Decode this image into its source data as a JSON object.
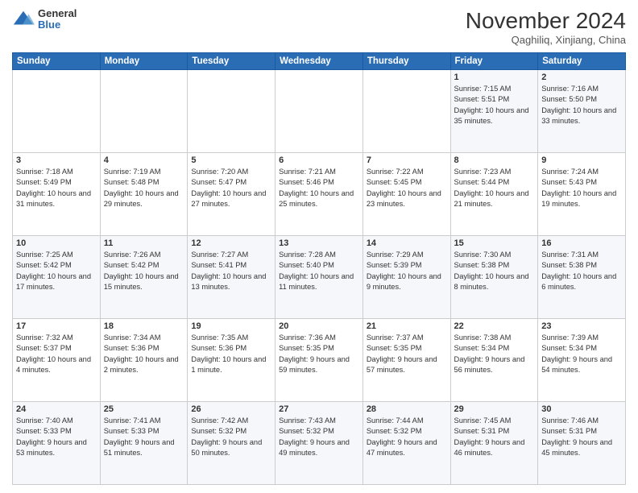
{
  "header": {
    "logo_general": "General",
    "logo_blue": "Blue",
    "month_title": "November 2024",
    "location": "Qaghiliq, Xinjiang, China"
  },
  "weekdays": [
    "Sunday",
    "Monday",
    "Tuesday",
    "Wednesday",
    "Thursday",
    "Friday",
    "Saturday"
  ],
  "weeks": [
    [
      {
        "day": "",
        "info": ""
      },
      {
        "day": "",
        "info": ""
      },
      {
        "day": "",
        "info": ""
      },
      {
        "day": "",
        "info": ""
      },
      {
        "day": "",
        "info": ""
      },
      {
        "day": "1",
        "info": "Sunrise: 7:15 AM\nSunset: 5:51 PM\nDaylight: 10 hours and 35 minutes."
      },
      {
        "day": "2",
        "info": "Sunrise: 7:16 AM\nSunset: 5:50 PM\nDaylight: 10 hours and 33 minutes."
      }
    ],
    [
      {
        "day": "3",
        "info": "Sunrise: 7:18 AM\nSunset: 5:49 PM\nDaylight: 10 hours and 31 minutes."
      },
      {
        "day": "4",
        "info": "Sunrise: 7:19 AM\nSunset: 5:48 PM\nDaylight: 10 hours and 29 minutes."
      },
      {
        "day": "5",
        "info": "Sunrise: 7:20 AM\nSunset: 5:47 PM\nDaylight: 10 hours and 27 minutes."
      },
      {
        "day": "6",
        "info": "Sunrise: 7:21 AM\nSunset: 5:46 PM\nDaylight: 10 hours and 25 minutes."
      },
      {
        "day": "7",
        "info": "Sunrise: 7:22 AM\nSunset: 5:45 PM\nDaylight: 10 hours and 23 minutes."
      },
      {
        "day": "8",
        "info": "Sunrise: 7:23 AM\nSunset: 5:44 PM\nDaylight: 10 hours and 21 minutes."
      },
      {
        "day": "9",
        "info": "Sunrise: 7:24 AM\nSunset: 5:43 PM\nDaylight: 10 hours and 19 minutes."
      }
    ],
    [
      {
        "day": "10",
        "info": "Sunrise: 7:25 AM\nSunset: 5:42 PM\nDaylight: 10 hours and 17 minutes."
      },
      {
        "day": "11",
        "info": "Sunrise: 7:26 AM\nSunset: 5:42 PM\nDaylight: 10 hours and 15 minutes."
      },
      {
        "day": "12",
        "info": "Sunrise: 7:27 AM\nSunset: 5:41 PM\nDaylight: 10 hours and 13 minutes."
      },
      {
        "day": "13",
        "info": "Sunrise: 7:28 AM\nSunset: 5:40 PM\nDaylight: 10 hours and 11 minutes."
      },
      {
        "day": "14",
        "info": "Sunrise: 7:29 AM\nSunset: 5:39 PM\nDaylight: 10 hours and 9 minutes."
      },
      {
        "day": "15",
        "info": "Sunrise: 7:30 AM\nSunset: 5:38 PM\nDaylight: 10 hours and 8 minutes."
      },
      {
        "day": "16",
        "info": "Sunrise: 7:31 AM\nSunset: 5:38 PM\nDaylight: 10 hours and 6 minutes."
      }
    ],
    [
      {
        "day": "17",
        "info": "Sunrise: 7:32 AM\nSunset: 5:37 PM\nDaylight: 10 hours and 4 minutes."
      },
      {
        "day": "18",
        "info": "Sunrise: 7:34 AM\nSunset: 5:36 PM\nDaylight: 10 hours and 2 minutes."
      },
      {
        "day": "19",
        "info": "Sunrise: 7:35 AM\nSunset: 5:36 PM\nDaylight: 10 hours and 1 minute."
      },
      {
        "day": "20",
        "info": "Sunrise: 7:36 AM\nSunset: 5:35 PM\nDaylight: 9 hours and 59 minutes."
      },
      {
        "day": "21",
        "info": "Sunrise: 7:37 AM\nSunset: 5:35 PM\nDaylight: 9 hours and 57 minutes."
      },
      {
        "day": "22",
        "info": "Sunrise: 7:38 AM\nSunset: 5:34 PM\nDaylight: 9 hours and 56 minutes."
      },
      {
        "day": "23",
        "info": "Sunrise: 7:39 AM\nSunset: 5:34 PM\nDaylight: 9 hours and 54 minutes."
      }
    ],
    [
      {
        "day": "24",
        "info": "Sunrise: 7:40 AM\nSunset: 5:33 PM\nDaylight: 9 hours and 53 minutes."
      },
      {
        "day": "25",
        "info": "Sunrise: 7:41 AM\nSunset: 5:33 PM\nDaylight: 9 hours and 51 minutes."
      },
      {
        "day": "26",
        "info": "Sunrise: 7:42 AM\nSunset: 5:32 PM\nDaylight: 9 hours and 50 minutes."
      },
      {
        "day": "27",
        "info": "Sunrise: 7:43 AM\nSunset: 5:32 PM\nDaylight: 9 hours and 49 minutes."
      },
      {
        "day": "28",
        "info": "Sunrise: 7:44 AM\nSunset: 5:32 PM\nDaylight: 9 hours and 47 minutes."
      },
      {
        "day": "29",
        "info": "Sunrise: 7:45 AM\nSunset: 5:31 PM\nDaylight: 9 hours and 46 minutes."
      },
      {
        "day": "30",
        "info": "Sunrise: 7:46 AM\nSunset: 5:31 PM\nDaylight: 9 hours and 45 minutes."
      }
    ]
  ]
}
